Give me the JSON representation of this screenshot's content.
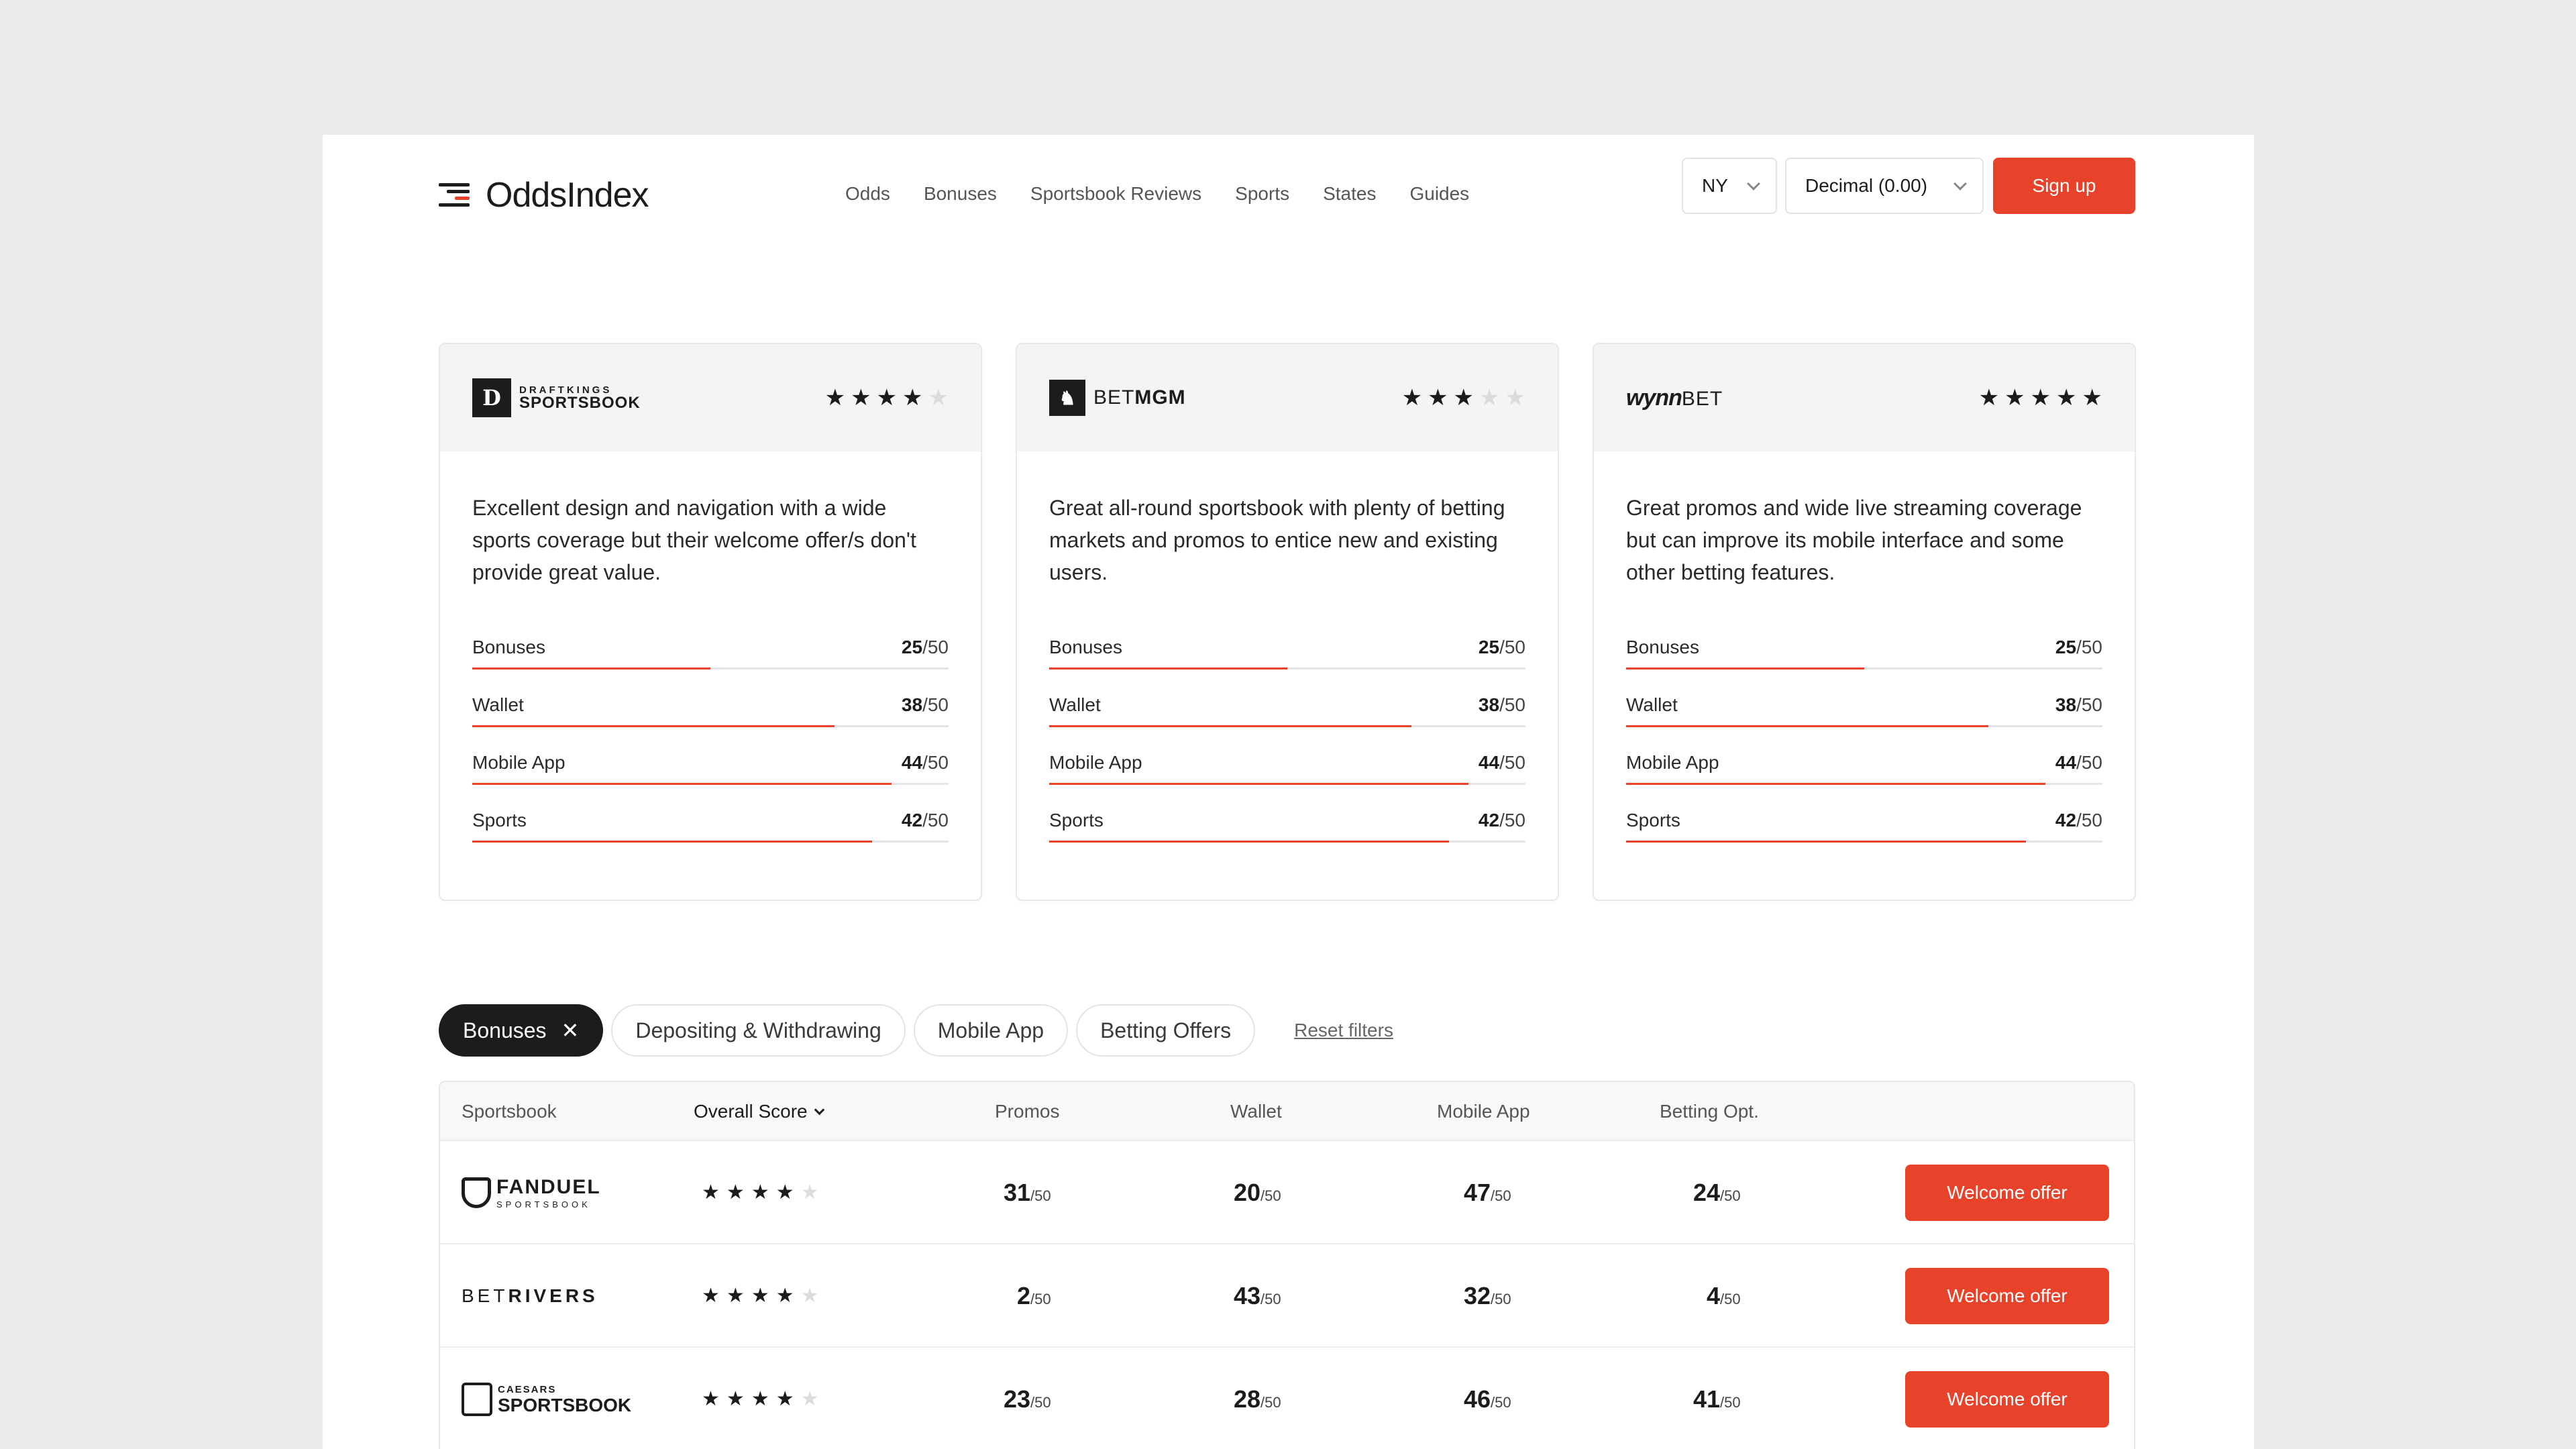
{
  "header": {
    "logo_text": "OddsIndex",
    "nav": [
      "Odds",
      "Bonuses",
      "Sportsbook Reviews",
      "Sports",
      "States",
      "Guides"
    ],
    "state_select": "NY",
    "odds_select": "Decimal (0.00)",
    "signup_label": "Sign up"
  },
  "cards": [
    {
      "brand_line1": "DRAFTKINGS",
      "brand_line2": "SPORTSBOOK",
      "rating": 4,
      "description": "Excellent design and navigation with a wide sports coverage but their welcome offer/s don't provide great value.",
      "scores": [
        {
          "label": "Bonuses",
          "value": "25",
          "max": "/50",
          "fraction": 0.5
        },
        {
          "label": "Wallet",
          "value": "38",
          "max": "/50",
          "fraction": 0.76
        },
        {
          "label": "Mobile App",
          "value": "44",
          "max": "/50",
          "fraction": 0.88
        },
        {
          "label": "Sports",
          "value": "42",
          "max": "/50",
          "fraction": 0.84
        }
      ]
    },
    {
      "brand_line1": "BET",
      "brand_line2": "MGM",
      "rating": 3,
      "description": "Great all-round sportsbook with plenty of betting markets and promos to entice new and existing users.",
      "scores": [
        {
          "label": "Bonuses",
          "value": "25",
          "max": "/50",
          "fraction": 0.5
        },
        {
          "label": "Wallet",
          "value": "38",
          "max": "/50",
          "fraction": 0.76
        },
        {
          "label": "Mobile App",
          "value": "44",
          "max": "/50",
          "fraction": 0.88
        },
        {
          "label": "Sports",
          "value": "42",
          "max": "/50",
          "fraction": 0.84
        }
      ]
    },
    {
      "brand_line1": "wynn",
      "brand_line2": "BET",
      "rating": 5,
      "description": "Great promos and wide live streaming coverage but can improve its mobile interface and some other betting features.",
      "scores": [
        {
          "label": "Bonuses",
          "value": "25",
          "max": "/50",
          "fraction": 0.5
        },
        {
          "label": "Wallet",
          "value": "38",
          "max": "/50",
          "fraction": 0.76
        },
        {
          "label": "Mobile App",
          "value": "44",
          "max": "/50",
          "fraction": 0.88
        },
        {
          "label": "Sports",
          "value": "42",
          "max": "/50",
          "fraction": 0.84
        }
      ]
    }
  ],
  "filters": {
    "chips": [
      "Bonuses",
      "Depositing & Withdrawing",
      "Mobile App",
      "Betting Offers"
    ],
    "active": "Bonuses",
    "reset_label": "Reset filters"
  },
  "table": {
    "headers": [
      "Sportsbook",
      "Overall Score",
      "Promos",
      "Wallet",
      "Mobile App",
      "Betting Opt."
    ],
    "max_suffix": "/50",
    "offer_label": "Welcome offer",
    "rows": [
      {
        "logo1": "FANDUEL",
        "logo2": "SPORTSBOOK",
        "rating": 4,
        "promos": "31",
        "wallet": "20",
        "mobile": "47",
        "betting": "24"
      },
      {
        "logo1": "BET",
        "logo2": "RIVERS",
        "rating": 4,
        "promos": "2",
        "wallet": "43",
        "mobile": "32",
        "betting": "4"
      },
      {
        "logo1": "CAESARS",
        "logo2": "SPORTSBOOK",
        "rating": 4,
        "promos": "23",
        "wallet": "28",
        "mobile": "46",
        "betting": "41"
      }
    ]
  },
  "colors": {
    "accent": "#e8432a",
    "dark": "#1c1c1c",
    "background": "#ebebeb"
  }
}
